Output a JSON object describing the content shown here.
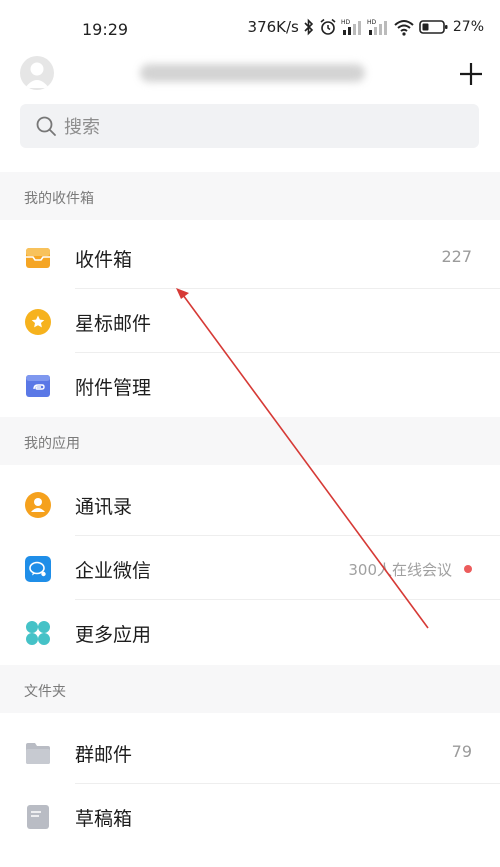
{
  "status_bar": {
    "time": "19:29",
    "network_speed": "376K/s",
    "battery_percent": "27%"
  },
  "search": {
    "placeholder": "搜索"
  },
  "sections": {
    "mailboxes": {
      "title": "我的收件箱",
      "items": [
        {
          "label": "收件箱",
          "count": "227",
          "icon": "inbox-icon"
        },
        {
          "label": "星标邮件",
          "icon": "star-icon"
        },
        {
          "label": "附件管理",
          "icon": "attachment-icon"
        }
      ]
    },
    "apps": {
      "title": "我的应用",
      "items": [
        {
          "label": "通讯录",
          "icon": "contacts-icon"
        },
        {
          "label": "企业微信",
          "note": "300人在线会议",
          "icon": "wecom-icon"
        },
        {
          "label": "更多应用",
          "icon": "more-apps-icon"
        }
      ]
    },
    "folders": {
      "title": "文件夹",
      "items": [
        {
          "label": "群邮件",
          "count": "79",
          "icon": "folder-icon"
        },
        {
          "label": "草稿箱",
          "icon": "drafts-icon"
        }
      ]
    }
  },
  "colors": {
    "inbox": "#f5a524",
    "star": "#f6b21d",
    "attachment": "#5a78e6",
    "contacts": "#f5a11d",
    "wecom": "#1f8ee8",
    "more_apps": "#45c2c7",
    "folder_gray": "#b9bcc4",
    "annotation_arrow": "#d63a36"
  }
}
